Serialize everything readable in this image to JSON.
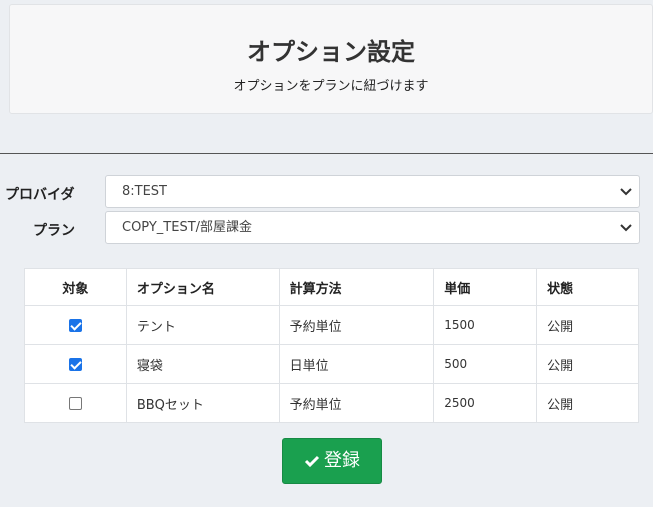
{
  "header": {
    "title": "オプション設定",
    "subtitle": "オプションをプランに紐づけます"
  },
  "form": {
    "provider_label": "プロバイダ",
    "provider_value": "8:TEST",
    "plan_label": "プラン",
    "plan_value": "COPY_TEST/部屋課金"
  },
  "table": {
    "headers": [
      "対象",
      "オプション名",
      "計算方法",
      "単価",
      "状態"
    ],
    "rows": [
      {
        "checked": true,
        "name": "テント",
        "method": "予約単位",
        "price": "1500",
        "status": "公開"
      },
      {
        "checked": true,
        "name": "寝袋",
        "method": "日単位",
        "price": "500",
        "status": "公開"
      },
      {
        "checked": false,
        "name": "BBQセット",
        "method": "予約単位",
        "price": "2500",
        "status": "公開"
      }
    ]
  },
  "submit_label": "登録",
  "colors": {
    "accent": "#1aa04f",
    "checkbox": "#1a73e8"
  }
}
